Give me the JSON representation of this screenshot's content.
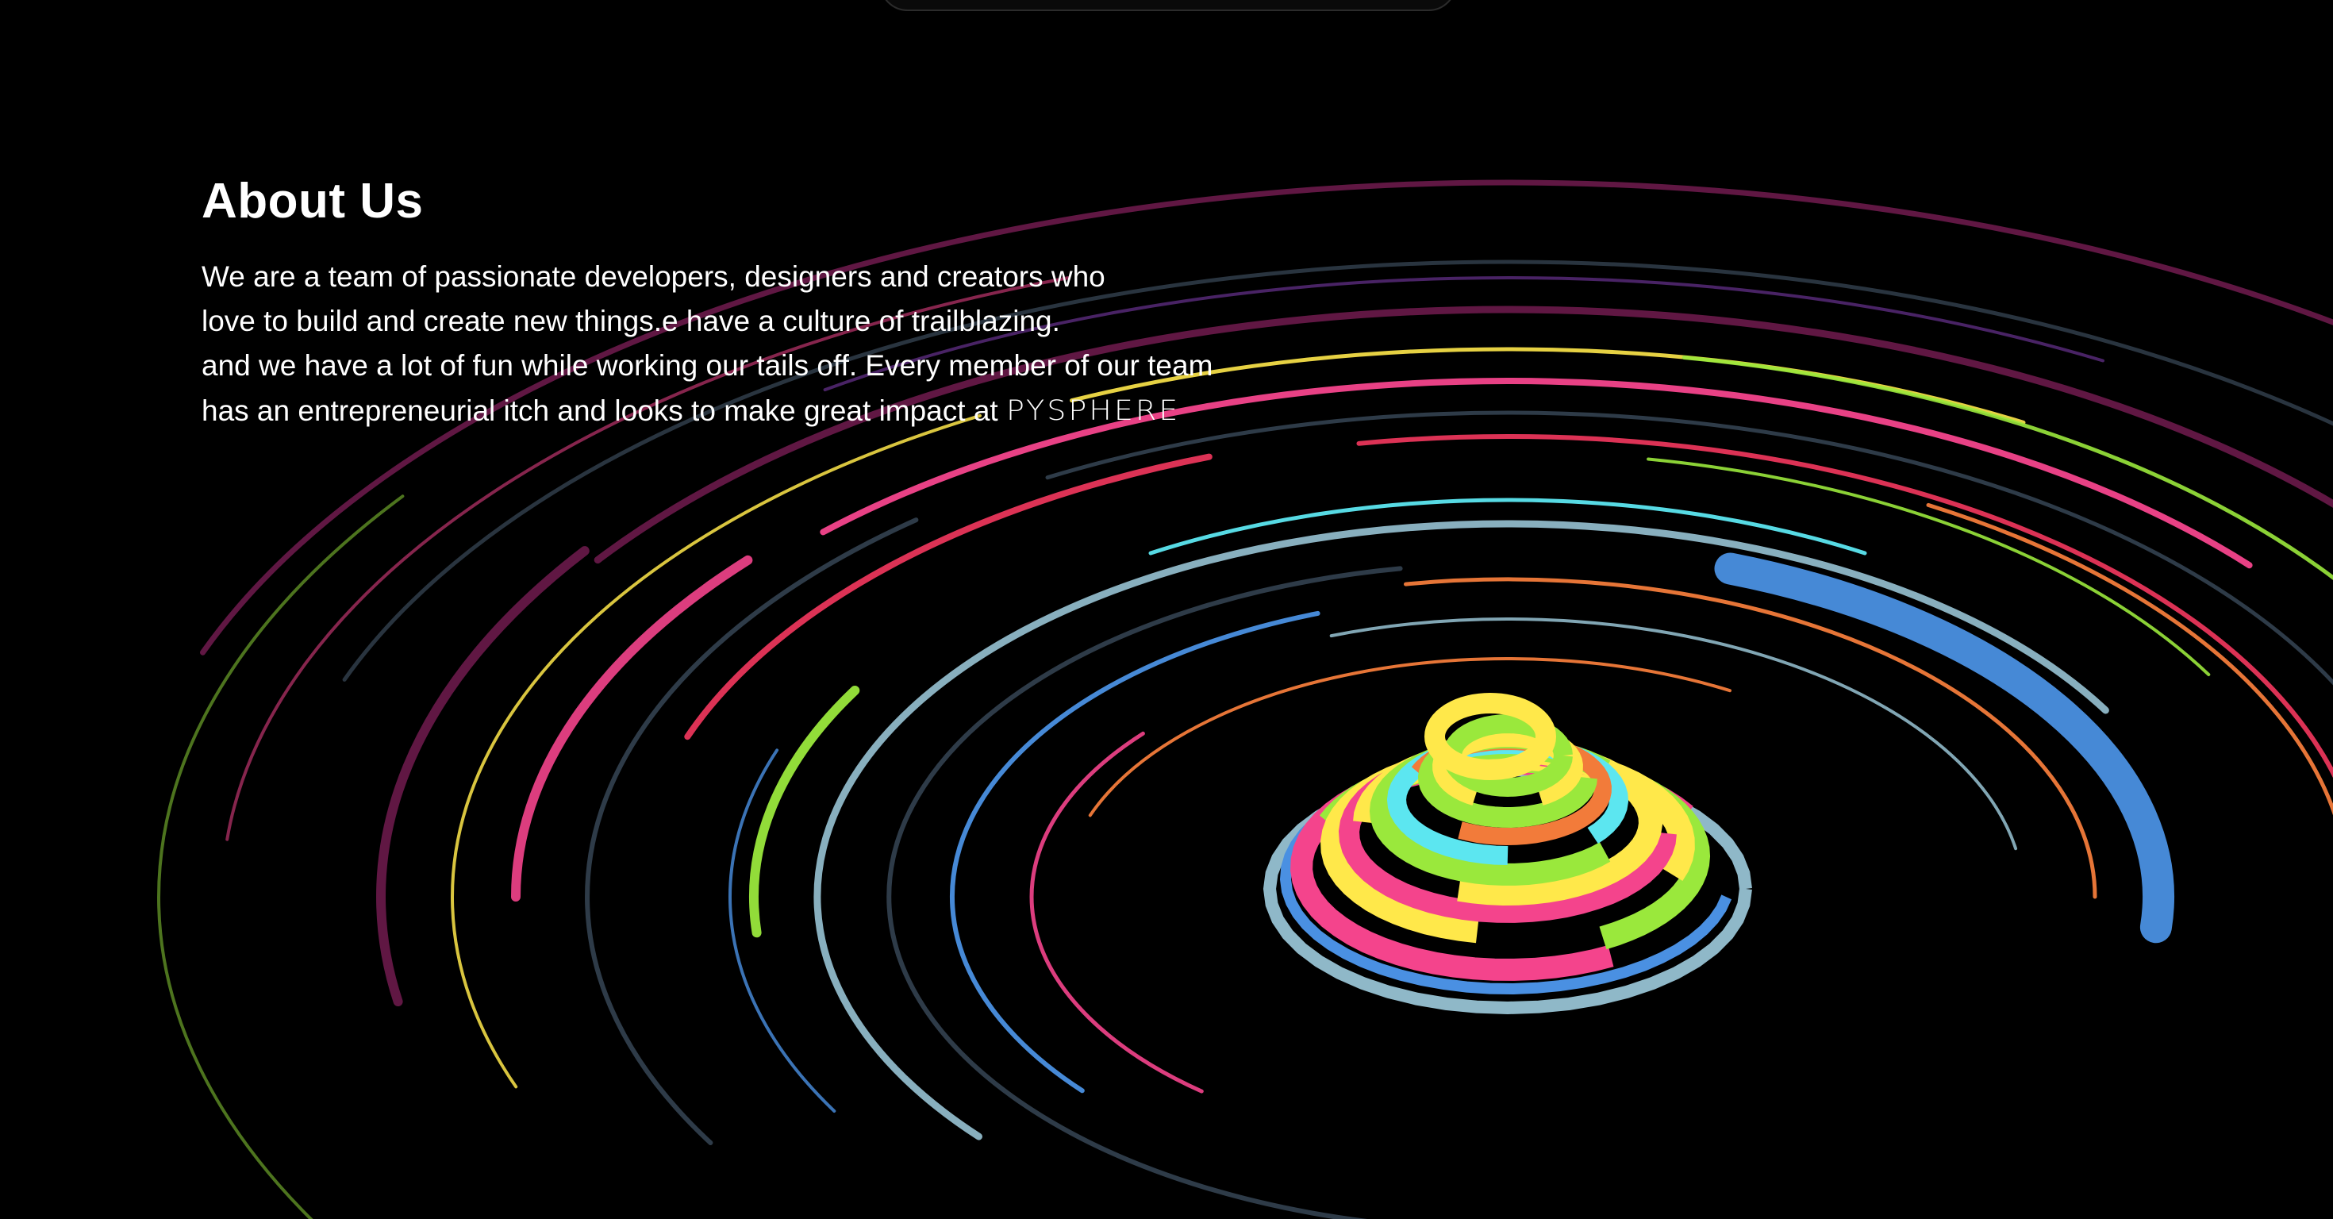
{
  "about": {
    "title": "About Us",
    "lines": [
      "We are a team of passionate developers, designers and creators who",
      "love to build and create new things.e have a culture of trailblazing.",
      "and we have a lot of fun while working our tails off. Every member of our team",
      "has an entrepreneurial itch and looks to make great impact at"
    ],
    "brand": "PYSPHERE"
  },
  "colors": {
    "background": "#000000",
    "text": "#ffffff",
    "palette": [
      "#f4448c",
      "#e8355a",
      "#ffe84a",
      "#9ae83c",
      "#4a90e2",
      "#5ce6f0",
      "#f27b3a",
      "#8fb8c8",
      "#6a1a4a",
      "#2b55c8",
      "#7a3aa8",
      "#3a4a5a"
    ]
  }
}
